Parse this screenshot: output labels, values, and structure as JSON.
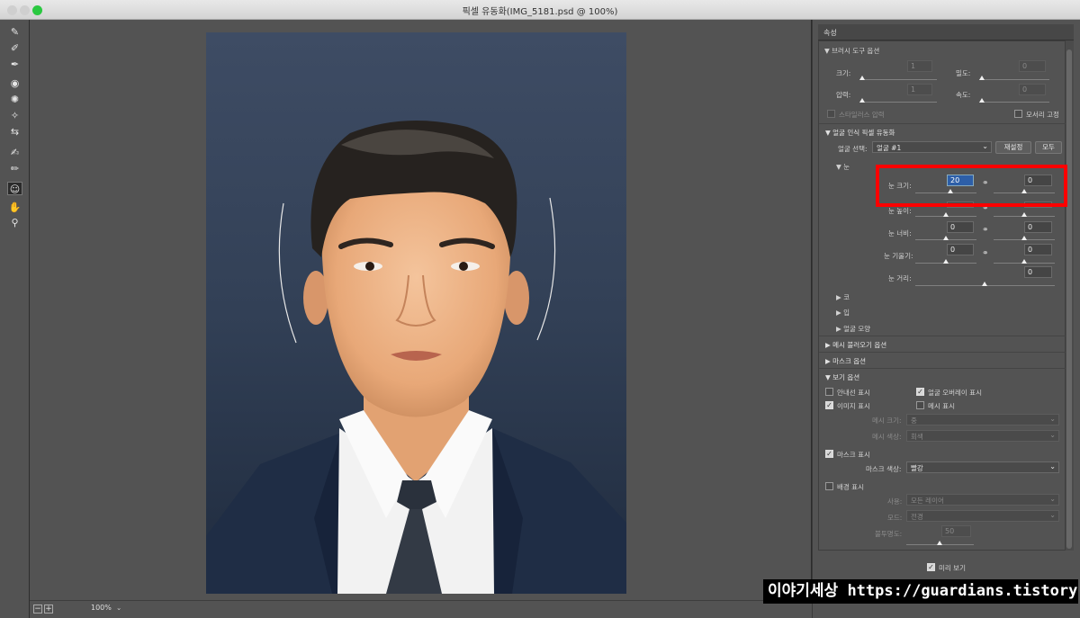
{
  "window": {
    "title": "픽셀 유동화(IMG_5181.psd @ 100%)"
  },
  "status": {
    "zoom": "100%"
  },
  "panel": {
    "tab": "속성",
    "brush_options": {
      "header": "브러시 도구 옵션",
      "size_label": "크기:",
      "size_value": "1",
      "density_label": "밀도:",
      "density_value": "0",
      "pressure_label": "압력:",
      "pressure_value": "1",
      "rate_label": "속도:",
      "rate_value": "0",
      "stylus_label": "스타일러스 압력",
      "pin_edges_label": "모서리 고정"
    },
    "face_aware": {
      "header": "얼굴 인식 픽셀 유동화",
      "select_face_label": "얼굴 선택:",
      "select_face_value": "얼굴 #1",
      "reset_button": "재설정",
      "all_button": "모두",
      "eyes_header": "눈",
      "eye_size_label": "눈 크기:",
      "eye_size_left": "20",
      "eye_size_right": "0",
      "eye_height_label": "눈 높이:",
      "eye_width_label": "눈 너비:",
      "eye_width_left": "0",
      "eye_width_right": "0",
      "eye_tilt_label": "눈 기울기:",
      "eye_tilt_left": "0",
      "eye_tilt_right": "0",
      "eye_distance_label": "눈 거리:",
      "eye_distance_value": "0",
      "nose_header": "코",
      "mouth_header": "입",
      "face_shape_header": "얼굴 모양"
    },
    "load_mesh_header": "메시 불러오기 옵션",
    "mask_options_header": "마스크 옵션",
    "view_options": {
      "header": "보기 옵션",
      "show_guides": "안내선 표시",
      "show_face_overlay": "얼굴 오버레이 표시",
      "show_image": "이미지 표시",
      "show_mesh": "메시 표시",
      "mesh_size_label": "메시 크기:",
      "mesh_size_value": "중",
      "mesh_color_label": "메시 색상:",
      "mesh_color_value": "회색",
      "show_mask": "마스크 표시",
      "mask_color_label": "마스크 색상:",
      "mask_color_value": "빨강",
      "show_backdrop": "배경 표시",
      "use_label": "사용:",
      "use_value": "모든 레이어",
      "mode_label": "모드:",
      "mode_value": "전경",
      "opacity_label": "불투명도:",
      "opacity_value": "50"
    },
    "preview_label": "미리 보기"
  },
  "watermark": {
    "brand": "이야기세상",
    "url": " https://guardians.tistory.com"
  }
}
